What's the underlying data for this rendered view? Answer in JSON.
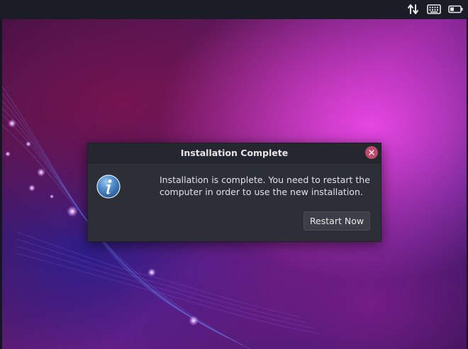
{
  "topbar": {
    "icons": [
      "network-transfer-icon",
      "keyboard-icon",
      "battery-icon"
    ]
  },
  "dialog": {
    "title": "Installation Complete",
    "message": "Installation is complete. You need to restart the computer in order to use the new installation.",
    "icon": "info-icon",
    "close_icon": "close-icon",
    "restart_label": "Restart Now"
  },
  "colors": {
    "dialog_background": "#2d2f37",
    "dialog_header": "#25272e",
    "close_button": "#c0486b",
    "button_background": "#3d3f48",
    "topbar": "#1b1d26",
    "info_icon": "#4a86c4"
  }
}
